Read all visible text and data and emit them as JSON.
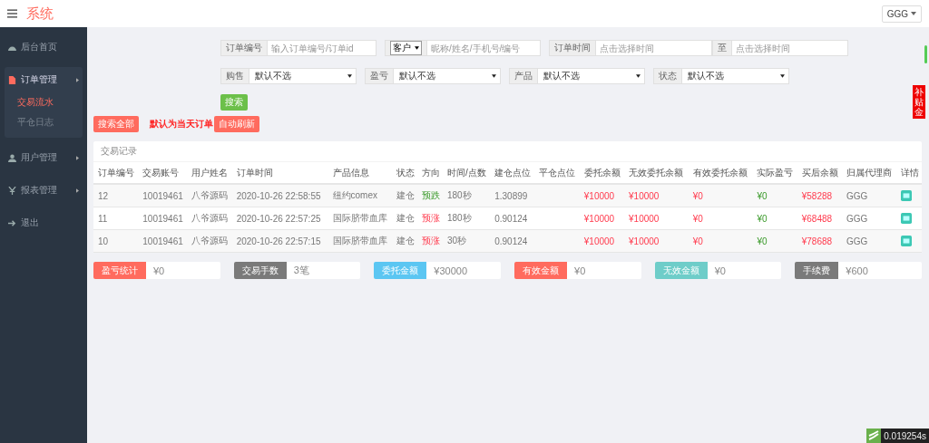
{
  "header": {
    "title": "系统",
    "user": "GGG"
  },
  "sidebar": [
    {
      "label": "后台首页",
      "expanded": false
    },
    {
      "label": "订单管理",
      "expanded": true,
      "children": [
        {
          "label": "交易流水",
          "selected": true
        },
        {
          "label": "平仓日志",
          "selected": false
        }
      ]
    },
    {
      "label": "用户管理",
      "expanded": false
    },
    {
      "label": "报表管理",
      "expanded": false
    },
    {
      "label": "退出",
      "expanded": false
    }
  ],
  "filters": [
    [
      {
        "kind": "input",
        "label": "订单编号",
        "placeholder": "输入订单编号/订单id"
      },
      {
        "kind": "select-input",
        "label": "客户",
        "placeholder": "昵称/姓名/手机号/编号"
      },
      {
        "kind": "range",
        "label": "订单时间",
        "placeholder": "点击选择时间",
        "label2": "至",
        "placeholder2": "点击选择时间"
      }
    ],
    [
      {
        "kind": "select",
        "label": "购售",
        "value": "默认不选"
      },
      {
        "kind": "select",
        "label": "盈亏",
        "value": "默认不选"
      },
      {
        "kind": "select",
        "label": "产品",
        "value": "默认不选"
      },
      {
        "kind": "select",
        "label": "状态",
        "value": "默认不选"
      }
    ]
  ],
  "search_button": "搜索",
  "actions": {
    "search_all": "搜索全部",
    "note": "默认为当天订单",
    "auto_refresh": "自动刷新"
  },
  "table": {
    "title": "交易记录",
    "columns": [
      "订单编号",
      "交易账号",
      "用户姓名",
      "订单时间",
      "产品信息",
      "状态",
      "方向",
      "时间/点数",
      "建仓点位",
      "平仓点位",
      "委托余额",
      "无效委托余额",
      "有效委托余额",
      "实际盈亏",
      "买后余额",
      "归属代理商",
      "详情"
    ],
    "rows": [
      {
        "cells": [
          "12",
          "10019461",
          "八爷源码",
          "2020-10-26 22:58:55",
          "纽约comex",
          "建仓",
          "预跌",
          "180秒",
          "1.30899",
          "",
          "¥10000",
          "¥10000",
          "¥0",
          "¥0",
          "¥58288",
          "GGG"
        ],
        "rising": false
      },
      {
        "cells": [
          "11",
          "10019461",
          "八爷源码",
          "2020-10-26 22:57:25",
          "国际脐带血库",
          "建仓",
          "预涨",
          "180秒",
          "0.90124",
          "",
          "¥10000",
          "¥10000",
          "¥0",
          "¥0",
          "¥68488",
          "GGG"
        ],
        "rising": true
      },
      {
        "cells": [
          "10",
          "10019461",
          "八爷源码",
          "2020-10-26 22:57:15",
          "国际脐带血库",
          "建仓",
          "预涨",
          "30秒",
          "0.90124",
          "",
          "¥10000",
          "¥10000",
          "¥0",
          "¥0",
          "¥78688",
          "GGG"
        ],
        "rising": true
      }
    ]
  },
  "summary": [
    {
      "label": "盈亏统计",
      "value": "¥0",
      "color": "#ff6b5e"
    },
    {
      "label": "交易手数",
      "value": "3笔",
      "color": "#7a7a7a"
    },
    {
      "label": "委托金额",
      "value": "¥30000",
      "color": "#5bc6f2"
    },
    {
      "label": "有效金额",
      "value": "¥0",
      "color": "#ff6b5e"
    },
    {
      "label": "无效金额",
      "value": "¥0",
      "color": "#6ecdc9"
    },
    {
      "label": "手续费",
      "value": "¥600",
      "color": "#7a7a7a"
    }
  ],
  "side_tab": "补贴金",
  "trace": "0.019254s"
}
